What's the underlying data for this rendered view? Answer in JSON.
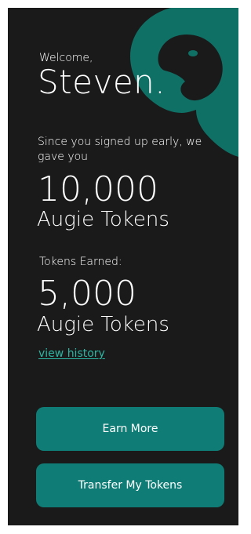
{
  "header": {
    "greeting": "Welcome,",
    "name": "Steven.",
    "logo_icon": "dog-head-icon"
  },
  "signup_bonus": {
    "intro": "Since you signed up early, we gave you",
    "amount": "10,000",
    "unit": "Augie Tokens"
  },
  "earned": {
    "label": "Tokens Earned:",
    "amount": "5,000",
    "unit": "Augie Tokens",
    "history_link": "view history"
  },
  "actions": {
    "earn_more": "Earn More",
    "transfer": "Transfer My Tokens"
  },
  "colors": {
    "background": "#1a1a1a",
    "accent": "#0f7d76",
    "link": "#2bb5a3",
    "logo": "#0f7066"
  }
}
